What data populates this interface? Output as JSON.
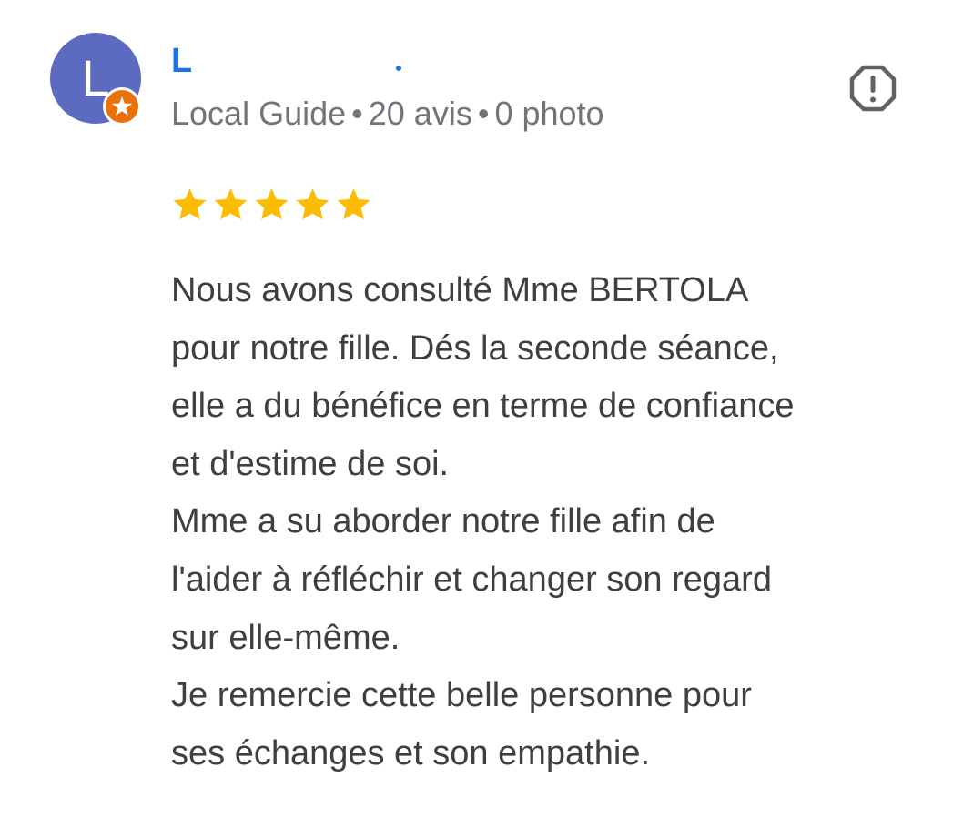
{
  "author": {
    "initial": "L",
    "name": "L",
    "avatar_color": "#5c6bc0",
    "badge_icon": "local-guide-star-icon",
    "badge_color": "#e8710a",
    "meta": {
      "level": "Local Guide",
      "reviews": "20 avis",
      "photos": "0 photo",
      "separator": "•"
    }
  },
  "actions": {
    "report_icon": "report-flag-icon"
  },
  "rating": {
    "stars": 5,
    "max": 5,
    "color": "#fbbc04"
  },
  "review": {
    "lines": [
      "Nous avons consulté Mme BERTOLA",
      "pour notre fille. Dés la seconde séance,",
      "elle a du bénéfice en terme de confiance",
      "et d'estime de soi.",
      "Mme a su aborder notre fille afin de",
      "l'aider à réfléchir et changer son regard",
      "sur elle-même.",
      "Je remercie cette belle personne pour",
      "ses échanges et son empathie."
    ]
  }
}
